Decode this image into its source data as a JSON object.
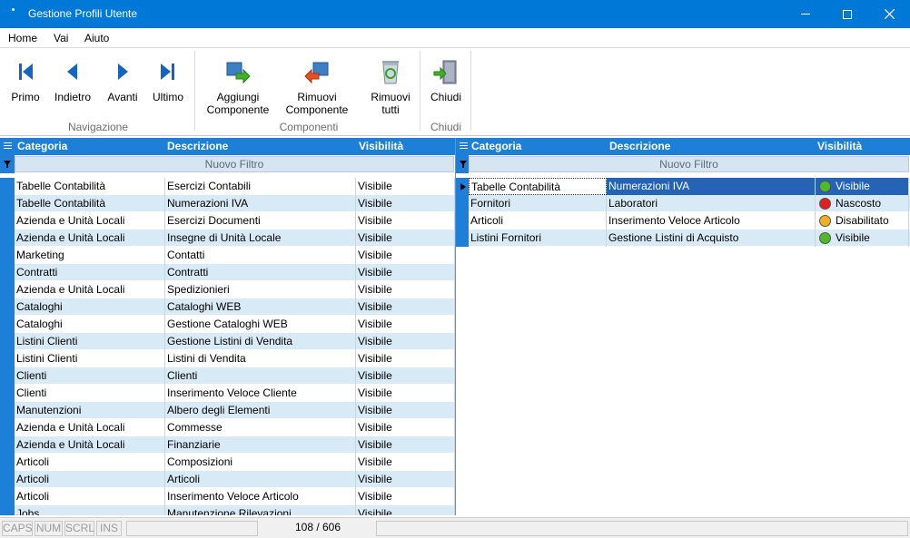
{
  "window": {
    "title": "Gestione Profili Utente"
  },
  "menu": [
    "Home",
    "Vai",
    "Aiuto"
  ],
  "ribbon": {
    "buttons": [
      {
        "id": "primo",
        "label": "Primo",
        "icon": "first-icon"
      },
      {
        "id": "indietro",
        "label": "Indietro",
        "icon": "prev-icon"
      },
      {
        "id": "avanti",
        "label": "Avanti",
        "icon": "next-icon"
      },
      {
        "id": "ultimo",
        "label": "Ultimo",
        "icon": "last-icon"
      },
      {
        "id": "aggiungi",
        "label": "Aggiungi\nComponente",
        "icon": "add-component-icon"
      },
      {
        "id": "rimuovi",
        "label": "Rimuovi\nComponente",
        "icon": "remove-component-icon"
      },
      {
        "id": "rimuovi_tutti",
        "label": "Rimuovi\ntutti",
        "icon": "recycle-bin-icon"
      },
      {
        "id": "chiudi",
        "label": "Chiudi",
        "icon": "exit-door-icon"
      }
    ],
    "groups": [
      "Navigazione",
      "Componenti",
      "Chiudi"
    ]
  },
  "grids": {
    "headers": [
      "Categoria",
      "Descrizione",
      "Visibilità"
    ],
    "filter_text": "Nuovo Filtro",
    "left_rows": [
      [
        "Tabelle Contabilità",
        "Esercizi Contabili",
        "Visibile"
      ],
      [
        "Tabelle Contabilità",
        "Numerazioni IVA",
        "Visibile"
      ],
      [
        "Azienda e Unità Locali",
        "Esercizi Documenti",
        "Visibile"
      ],
      [
        "Azienda e Unità Locali",
        "Insegne di Unità Locale",
        "Visibile"
      ],
      [
        "Marketing",
        "Contatti",
        "Visibile"
      ],
      [
        "Contratti",
        "Contratti",
        "Visibile"
      ],
      [
        "Azienda e Unità Locali",
        "Spedizionieri",
        "Visibile"
      ],
      [
        "Cataloghi",
        "Cataloghi WEB",
        "Visibile"
      ],
      [
        "Cataloghi",
        "Gestione Cataloghi WEB",
        "Visibile"
      ],
      [
        "Listini Clienti",
        "Gestione Listini di Vendita",
        "Visibile"
      ],
      [
        "Listini Clienti",
        "Listini di Vendita",
        "Visibile"
      ],
      [
        "Clienti",
        "Clienti",
        "Visibile"
      ],
      [
        "Clienti",
        "Inserimento Veloce Cliente",
        "Visibile"
      ],
      [
        "Manutenzioni",
        "Albero degli Elementi",
        "Visibile"
      ],
      [
        "Azienda e Unità Locali",
        "Commesse",
        "Visibile"
      ],
      [
        "Azienda e Unità Locali",
        "Finanziarie",
        "Visibile"
      ],
      [
        "Articoli",
        "Composizioni",
        "Visibile"
      ],
      [
        "Articoli",
        "Articoli",
        "Visibile"
      ],
      [
        "Articoli",
        "Inserimento Veloce Articolo",
        "Visibile"
      ],
      [
        "Jobs",
        "Manutenzione Rilevazioni",
        "Visibile"
      ]
    ],
    "right_rows": [
      {
        "cat": "Tabelle Contabilità",
        "desc": "Numerazioni IVA",
        "vis": "Visibile",
        "status_color": "#4cbb2a"
      },
      {
        "cat": "Fornitori",
        "desc": "Laboratori",
        "vis": "Nascosto",
        "status_color": "#e02020"
      },
      {
        "cat": "Articoli",
        "desc": "Inserimento Veloce Articolo",
        "vis": "Disabilitato",
        "status_color": "#f0b020"
      },
      {
        "cat": "Listini Fornitori",
        "desc": "Gestione Listini di Acquisto",
        "vis": "Visibile",
        "status_color": "#4cbb2a"
      }
    ]
  },
  "status": {
    "caps": "CAPS",
    "num": "NUM",
    "scrl": "SCRL",
    "ins": "INS",
    "record_count": "108 / 606"
  }
}
